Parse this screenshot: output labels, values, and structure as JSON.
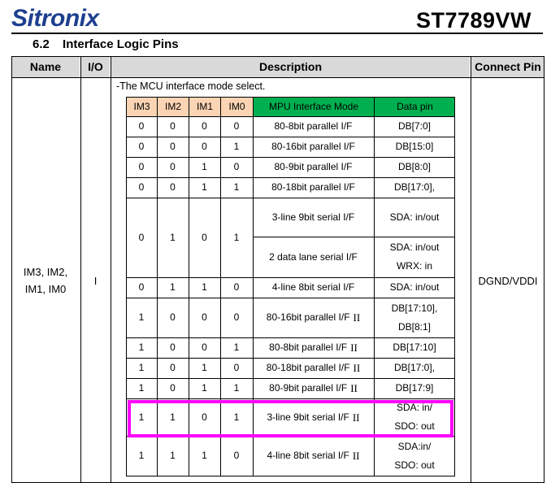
{
  "header": {
    "logo_text": "Sitronix",
    "model": "ST7789VW",
    "section_number": "6.2",
    "section_title": "Interface Logic Pins"
  },
  "table": {
    "headers": {
      "name": "Name",
      "io": "I/O",
      "description": "Description",
      "connect": "Connect Pin"
    },
    "pin_name": "IM3, IM2,\nIM1, IM0",
    "io": "I",
    "connect_pin": "DGND/VDDI",
    "intro": "-The MCU interface mode select.",
    "inner_headers": [
      "IM3",
      "IM2",
      "IM1",
      "IM0",
      "MPU Interface Mode",
      "Data pin"
    ],
    "rows": [
      {
        "im": [
          "0",
          "0",
          "0",
          "0"
        ],
        "mode": "80-8bit parallel I/F",
        "roman": "",
        "data": "DB[7:0]"
      },
      {
        "im": [
          "0",
          "0",
          "0",
          "1"
        ],
        "mode": "80-16bit parallel I/F",
        "roman": "",
        "data": "DB[15:0]"
      },
      {
        "im": [
          "0",
          "0",
          "1",
          "0"
        ],
        "mode": "80-9bit parallel I/F",
        "roman": "",
        "data": "DB[8:0]"
      },
      {
        "im": [
          "0",
          "0",
          "1",
          "1"
        ],
        "mode": "80-18bit parallel I/F",
        "roman": "",
        "data": "DB[17:0],"
      },
      {
        "im": [
          "0",
          "1",
          "0",
          "1"
        ],
        "modes": [
          "3-line 9bit serial I/F",
          "2 data lane serial I/F"
        ],
        "data_multi": [
          "SDA: in/out",
          "SDA: in/out\nWRX: in"
        ]
      },
      {
        "im": [
          "0",
          "1",
          "1",
          "0"
        ],
        "mode": "4-line 8bit serial I/F",
        "roman": "",
        "data": "SDA: in/out"
      },
      {
        "im": [
          "1",
          "0",
          "0",
          "0"
        ],
        "mode": "80-16bit parallel I/F",
        "roman": "II",
        "data": "DB[17:10],\nDB[8:1]"
      },
      {
        "im": [
          "1",
          "0",
          "0",
          "1"
        ],
        "mode": "80-8bit parallel I/F",
        "roman": "II",
        "data": "DB[17:10]"
      },
      {
        "im": [
          "1",
          "0",
          "1",
          "0"
        ],
        "mode": "80-18bit parallel I/F",
        "roman": "II",
        "data": "DB[17:0],"
      },
      {
        "im": [
          "1",
          "0",
          "1",
          "1"
        ],
        "mode": "80-9bit parallel I/F",
        "roman": "II",
        "data": "DB[17:9]"
      },
      {
        "im": [
          "1",
          "1",
          "0",
          "1"
        ],
        "mode": "3-line 9bit serial I/F",
        "roman": "II",
        "data": "SDA: in/\nSDO: out"
      },
      {
        "im": [
          "1",
          "1",
          "1",
          "0"
        ],
        "mode": "4-line 8bit serial I/F",
        "roman": "II",
        "data": "SDA:in/\nSDO: out"
      }
    ],
    "highlight_color": "#ff00ff",
    "header_gray": "#d9d9d9",
    "im_header_color": "#fbd4b4",
    "mode_header_color": "#00b050"
  }
}
